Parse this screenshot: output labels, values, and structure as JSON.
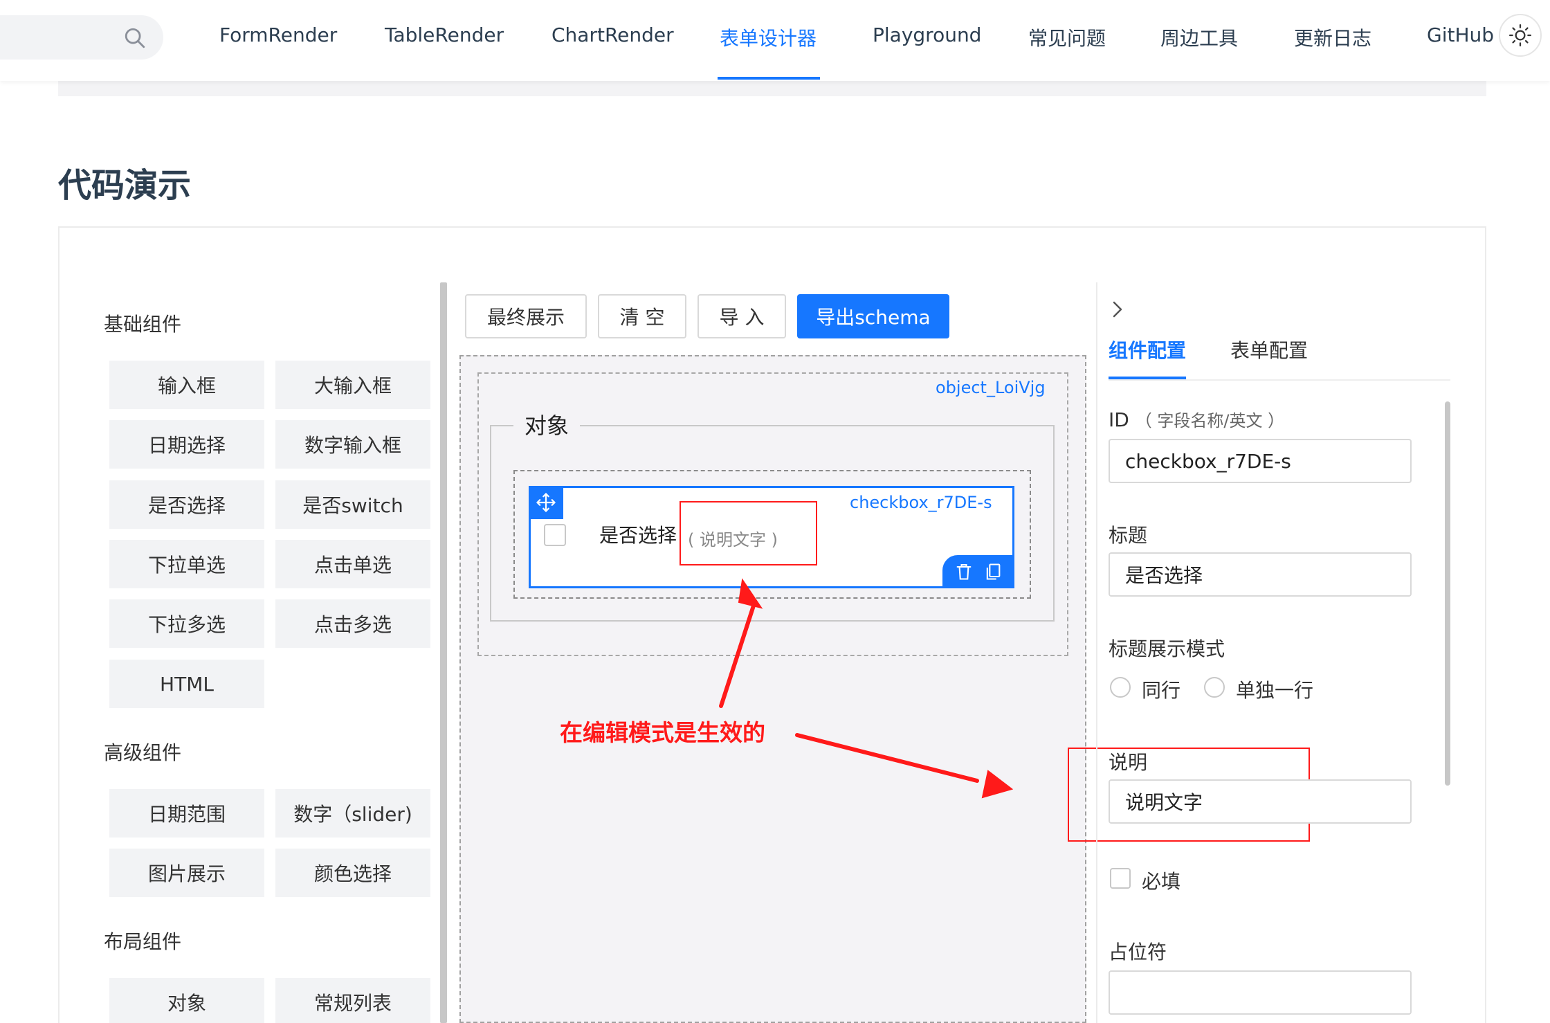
{
  "nav": {
    "items": [
      "FormRender",
      "TableRender",
      "ChartRender",
      "表单设计器",
      "Playground",
      "常见问题",
      "周边工具",
      "更新日志",
      "GitHub"
    ],
    "active_index": 3
  },
  "page": {
    "title": "代码演示"
  },
  "left_panel": {
    "basic_title": "基础组件",
    "basic": [
      "输入框",
      "大输入框",
      "日期选择",
      "数字输入框",
      "是否选择",
      "是否switch",
      "下拉单选",
      "点击单选",
      "下拉多选",
      "点击多选",
      "HTML"
    ],
    "advanced_title": "高级组件",
    "advanced": [
      "日期范围",
      "数字（slider)",
      "图片展示",
      "颜色选择"
    ],
    "layout_title": "布局组件",
    "layout": [
      "对象",
      "常规列表"
    ]
  },
  "toolbar": {
    "preview": "最终展示",
    "clear": "清 空",
    "import": "导 入",
    "export": "导出schema"
  },
  "canvas": {
    "object_id": "object_LoiVjg",
    "object_title": "对象",
    "field_id": "checkbox_r7DE-s",
    "field_label": "是否选择",
    "field_desc": "( 说明文字 )"
  },
  "annotation": {
    "text": "在编辑模式是生效的",
    "color": "#ff1a1a"
  },
  "right_panel": {
    "tabs": [
      "组件配置",
      "表单配置"
    ],
    "id_label": "ID",
    "id_hint": "（ 字段名称/英文 ）",
    "id_value": "checkbox_r7DE-s",
    "title_label": "标题",
    "title_value": "是否选择",
    "title_mode_label": "标题展示模式",
    "title_mode_options": [
      "同行",
      "单独一行"
    ],
    "desc_label": "说明",
    "desc_value": "说明文字",
    "required_label": "必填",
    "placeholder_label": "占位符",
    "placeholder_value": ""
  },
  "colors": {
    "accent": "#1677ff",
    "annotation": "#ff1a1a"
  }
}
